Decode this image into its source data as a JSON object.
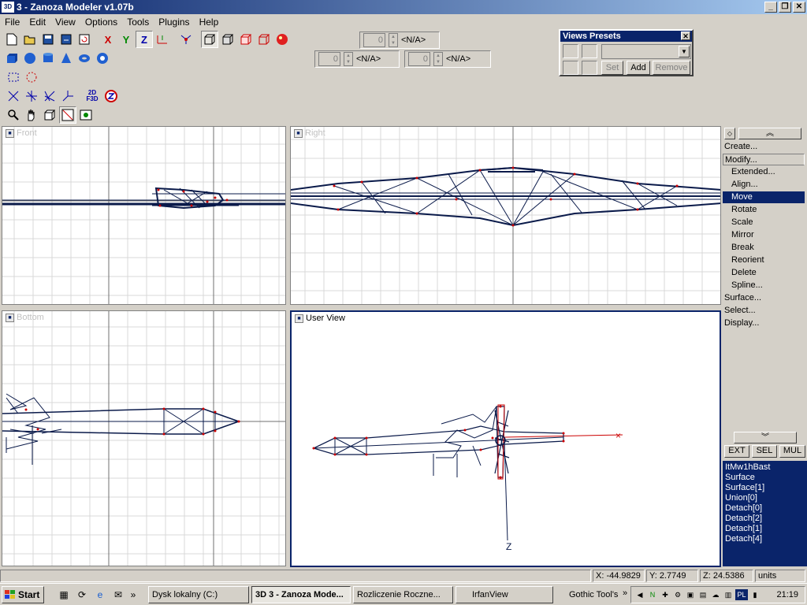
{
  "window": {
    "title": "3 - Zanoza Modeler v1.07b",
    "icon_text": "3D",
    "min": "_",
    "max": "❐",
    "close": "✕"
  },
  "menu": [
    "File",
    "Edit",
    "View",
    "Options",
    "Tools",
    "Plugins",
    "Help"
  ],
  "toolbar": {
    "axis_x": "X",
    "axis_y": "Y",
    "axis_z": "Z",
    "mode_2d3d": "2D F3D",
    "spinner_top": {
      "value": "0",
      "label": "<N/A>"
    },
    "spinner_left": {
      "value": "0",
      "label": "<N/A>"
    },
    "spinner_right": {
      "value": "0",
      "label": "<N/A>"
    }
  },
  "views_presets": {
    "title": "Views Presets",
    "set": "Set",
    "add": "Add",
    "remove": "Remove"
  },
  "viewports": {
    "front": "Front",
    "right": "Right",
    "bottom": "Bottom",
    "user": "User View",
    "axis_z": "Z"
  },
  "command_panel": {
    "items": [
      {
        "label": "Create...",
        "level": 0
      },
      {
        "label": "Modify...",
        "level": 0
      },
      {
        "label": "Extended...",
        "level": 1
      },
      {
        "label": "Align...",
        "level": 1
      },
      {
        "label": "Move",
        "level": 1,
        "selected": true
      },
      {
        "label": "Rotate",
        "level": 1
      },
      {
        "label": "Scale",
        "level": 1
      },
      {
        "label": "Mirror",
        "level": 1
      },
      {
        "label": "Break",
        "level": 1
      },
      {
        "label": "Reorient",
        "level": 1
      },
      {
        "label": "Delete",
        "level": 1
      },
      {
        "label": "Spline...",
        "level": 1
      },
      {
        "label": "Surface...",
        "level": 0
      },
      {
        "label": "Select...",
        "level": 0
      },
      {
        "label": "Display...",
        "level": 0
      }
    ],
    "ext": "EXT",
    "sel": "SEL",
    "mul": "MUL"
  },
  "object_list": [
    "ItMw1hBast",
    "Surface",
    "Surface[1]",
    "Union[0]",
    "Detach[0]",
    "Detach[2]",
    "Detach[1]",
    "Detach[4]"
  ],
  "status": {
    "x": "X: -44.9829",
    "y": "Y: 2.7749",
    "z": "Z: 24.5386",
    "units": "units"
  },
  "taskbar": {
    "start": "Start",
    "tasks": [
      "Dysk lokalny (C:)",
      "3D 3 - Zanoza Mode...",
      "Rozliczenie Roczne...",
      "IrfanView"
    ],
    "toolbar_label": "Gothic Tool's",
    "lang": "PL",
    "clock": "21:19"
  },
  "colors": {
    "accent": "#0a246a",
    "mesh": "#0a1a4a",
    "vertex": "#cc0000",
    "grid": "#d8d8d8",
    "axis": "#707070"
  }
}
